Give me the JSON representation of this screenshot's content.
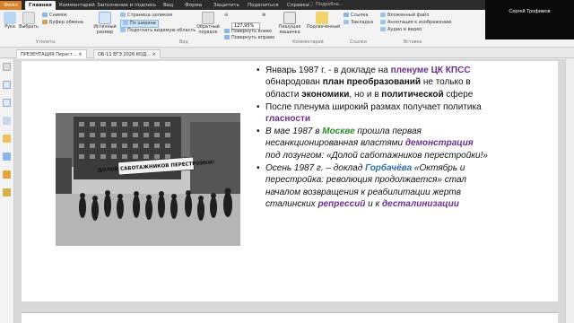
{
  "topbar": {
    "tabs": [
      "Файл",
      "Главная",
      "Комментарий",
      "Заполнение и подпись",
      "Вид",
      "Форма",
      "Защитить",
      "Поделиться",
      "Справка"
    ],
    "search_placeholder": "Подробне..."
  },
  "ribbon": {
    "hand": "Рука",
    "select": "Выбрать",
    "snapshot": "Снимок",
    "clipboard": "Буфер обмена",
    "group_tools": "Утилиты",
    "actual_size": "Истинный размер",
    "fit_page": "Страница целиком",
    "fit_width": "По ширине",
    "fit_visible": "Подогнать видимую область",
    "reverse_order": "Обратный порядок",
    "zoom_value": "127,95%",
    "rotate_left": "Повернуть влево",
    "rotate_right": "Повернуть вправо",
    "group_view": "Вид",
    "typewriter": "Пишущая машинка",
    "highlight": "Подсвеченный",
    "group_comment": "Комментарий",
    "link": "Ссылка",
    "bookmark": "Закладка",
    "group_links": "Ссылки",
    "attach_file": "Вложенный файл",
    "annotation": "Аннотация к изображению",
    "audio_video": "Аудио и видео",
    "group_insert": "Вставка"
  },
  "video": {
    "participant": "Сергей Трофимов"
  },
  "doctabs": [
    {
      "label": "ПРЕЗЕНТАЦИЯ Перест..."
    },
    {
      "label": "ОБ-11 ЕГЭ 2026 КОД..."
    }
  ],
  "slide": {
    "photo_banner": "ДОЛОЙ САБОТАЖНИКОВ ПЕРЕСТРОЙКИ!",
    "b1": [
      "Январь 1987 г. - в докладе на ",
      "пленуме ЦК КПСС",
      " обнародован ",
      "план преобразований",
      " не только в области ",
      "экономики",
      ", но и в ",
      "политической",
      " сфере"
    ],
    "b2": [
      "После пленума широкий размах получает политика ",
      "гласности"
    ],
    "b3": [
      "В мае 1987 в ",
      "Москве",
      " прошла первая несанкционированная властями ",
      "демонстрация",
      " под лозунгом: «Долой саботажников перестройки!»"
    ],
    "b4": [
      "Осень 1987 г. – доклад ",
      "Горбачёва",
      " «Октябрь и перестройка: революция продолжается» стал началом возвращения к реабилитации жертв сталинских ",
      "репрессий",
      " и к ",
      "десталинизации"
    ]
  },
  "colors": {
    "accent_purple": "#6b2f8e",
    "accent_green": "#2e8b2e",
    "accent_blue": "#2d6fa8",
    "file_tab": "#d9822b"
  }
}
